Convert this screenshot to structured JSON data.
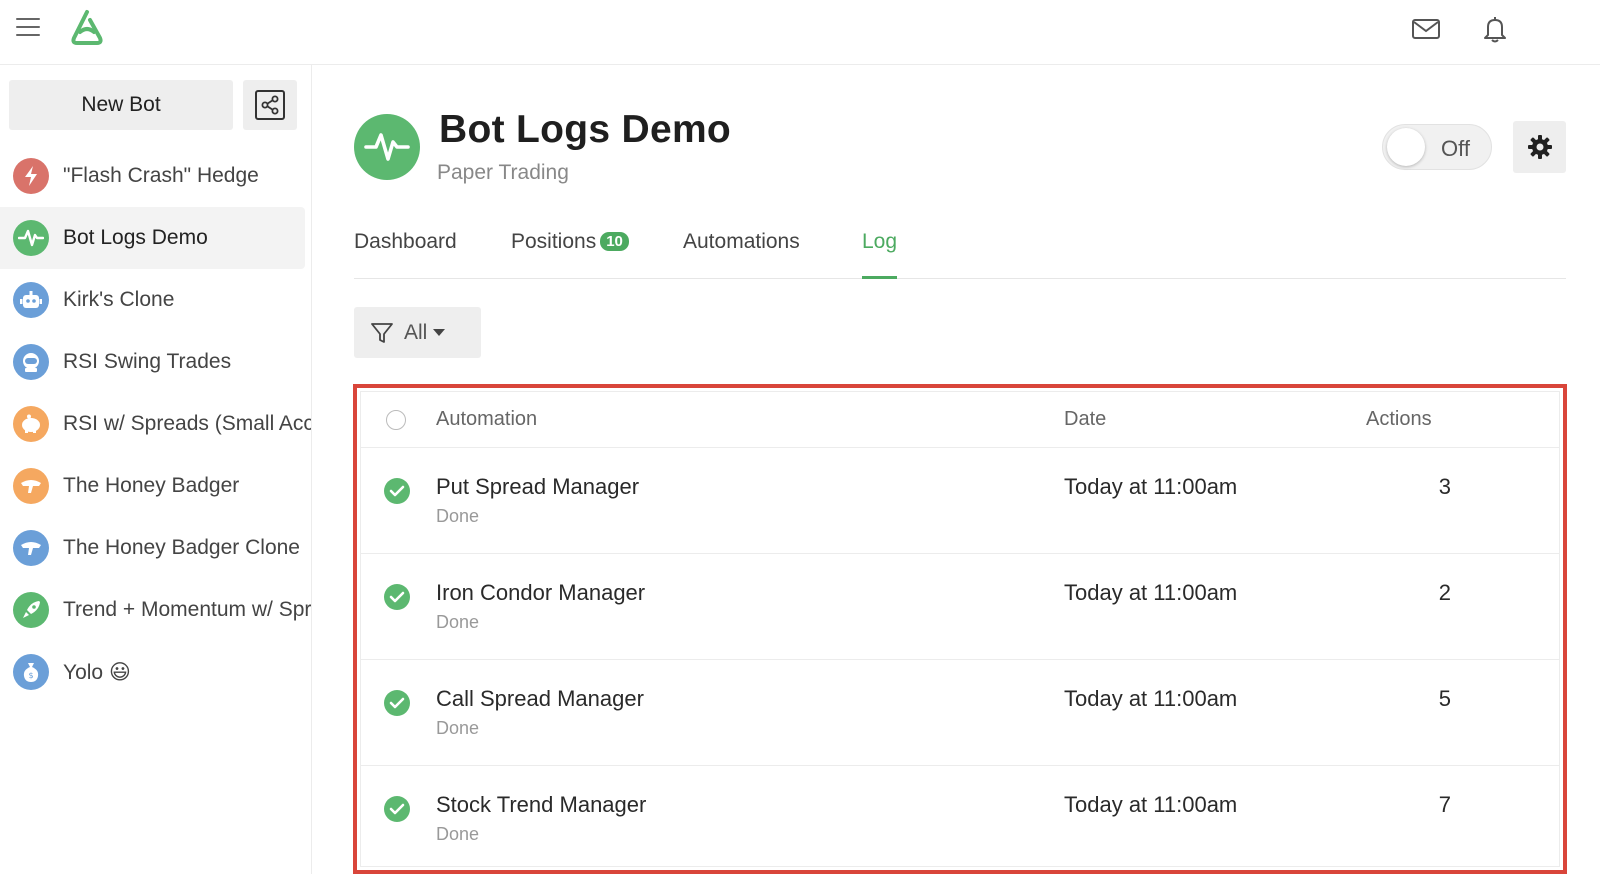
{
  "topbar": {
    "menu_icon": "hamburger-icon",
    "logo_icon": "app-logo-icon",
    "mail_icon": "mail-icon",
    "bell_icon": "bell-icon"
  },
  "sidebar": {
    "new_bot_label": "New Bot",
    "share_icon": "share-icon",
    "items": [
      {
        "label": "\"Flash Crash\" Hedge",
        "color": "#d9736a",
        "icon": "lightning-icon"
      },
      {
        "label": "Bot Logs Demo",
        "color": "#5cb870",
        "icon": "pulse-icon",
        "active": true
      },
      {
        "label": "Kirk's Clone",
        "color": "#6b9fd8",
        "icon": "robot-icon"
      },
      {
        "label": "RSI Swing Trades",
        "color": "#6b9fd8",
        "icon": "astronaut-icon"
      },
      {
        "label": "RSI w/ Spreads (Small Account)",
        "color": "#f5a860",
        "icon": "piggy-bank-icon"
      },
      {
        "label": "The Honey Badger",
        "color": "#f5a860",
        "icon": "badger-icon"
      },
      {
        "label": "The Honey Badger Clone",
        "color": "#6b9fd8",
        "icon": "badger-icon"
      },
      {
        "label": "Trend + Momentum w/ Spreads",
        "color": "#5cb870",
        "icon": "rocket-icon"
      },
      {
        "label": "Yolo 😃",
        "color": "#6b9fd8",
        "icon": "money-bag-icon"
      }
    ]
  },
  "header": {
    "title": "Bot Logs Demo",
    "subtitle": "Paper Trading",
    "avatar_icon": "pulse-icon",
    "toggle_label": "Off",
    "settings_icon": "gear-icon"
  },
  "tabs": [
    {
      "label": "Dashboard"
    },
    {
      "label": "Positions",
      "badge": "10"
    },
    {
      "label": "Automations"
    },
    {
      "label": "Log",
      "active": true
    }
  ],
  "filter": {
    "label": "All",
    "icon": "filter-icon"
  },
  "log": {
    "columns": {
      "automation": "Automation",
      "date": "Date",
      "actions": "Actions"
    },
    "rows": [
      {
        "name": "Put Spread Manager",
        "status": "Done",
        "date": "Today at 11:00am",
        "actions": "3"
      },
      {
        "name": "Iron Condor Manager",
        "status": "Done",
        "date": "Today at 11:00am",
        "actions": "2"
      },
      {
        "name": "Call Spread Manager",
        "status": "Done",
        "date": "Today at 11:00am",
        "actions": "5"
      },
      {
        "name": "Stock Trend Manager",
        "status": "Done",
        "date": "Today at 11:00am",
        "actions": "7"
      }
    ]
  },
  "colors": {
    "accent": "#4caa60",
    "highlight_border": "#d9453a"
  }
}
